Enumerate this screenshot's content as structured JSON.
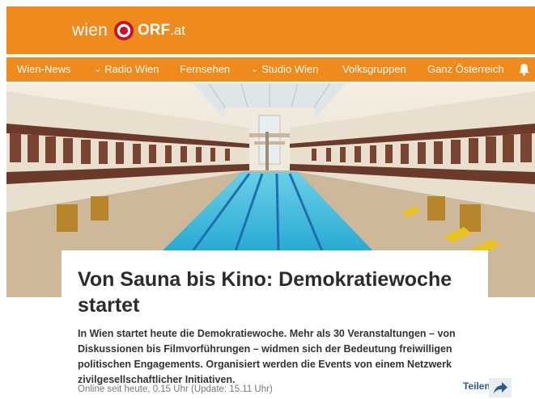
{
  "header": {
    "logo_wien": "wien",
    "logo_orf": "ORF",
    "logo_at": ".at",
    "bg_color": "#ef8a1c"
  },
  "nav": {
    "items": [
      {
        "label": "Wien-News",
        "has_dropdown": false
      },
      {
        "label": "Radio Wien",
        "has_dropdown": true
      },
      {
        "label": "Fernsehen",
        "has_dropdown": false
      },
      {
        "label": "Studio Wien",
        "has_dropdown": true
      },
      {
        "label": "Volksgruppen",
        "has_dropdown": false
      },
      {
        "label": "Ganz Österreich",
        "has_dropdown": false
      }
    ],
    "chevron_glyph": "⌄",
    "bell_icon": "bell-icon"
  },
  "hero": {
    "subject": "indoor-pool-photo"
  },
  "article": {
    "title": "Von Sauna bis Kino: Demokratiewoche startet",
    "lead": "In Wien startet heute die Demokratiewoche. Mehr als 30 Veranstaltungen – von Diskussionen bis Filmvorführungen – widmen sich der Bedeutung freiwilligen politischen Engagements. Organisiert werden die Events von einem Netzwerk zivilgesellschaftlicher Initiativen.",
    "meta": "Online seit heute, 0.15 Uhr (Update: 15.11 Uhr)",
    "share_label": "Teilen",
    "share_icon": "share-arrow-icon"
  }
}
